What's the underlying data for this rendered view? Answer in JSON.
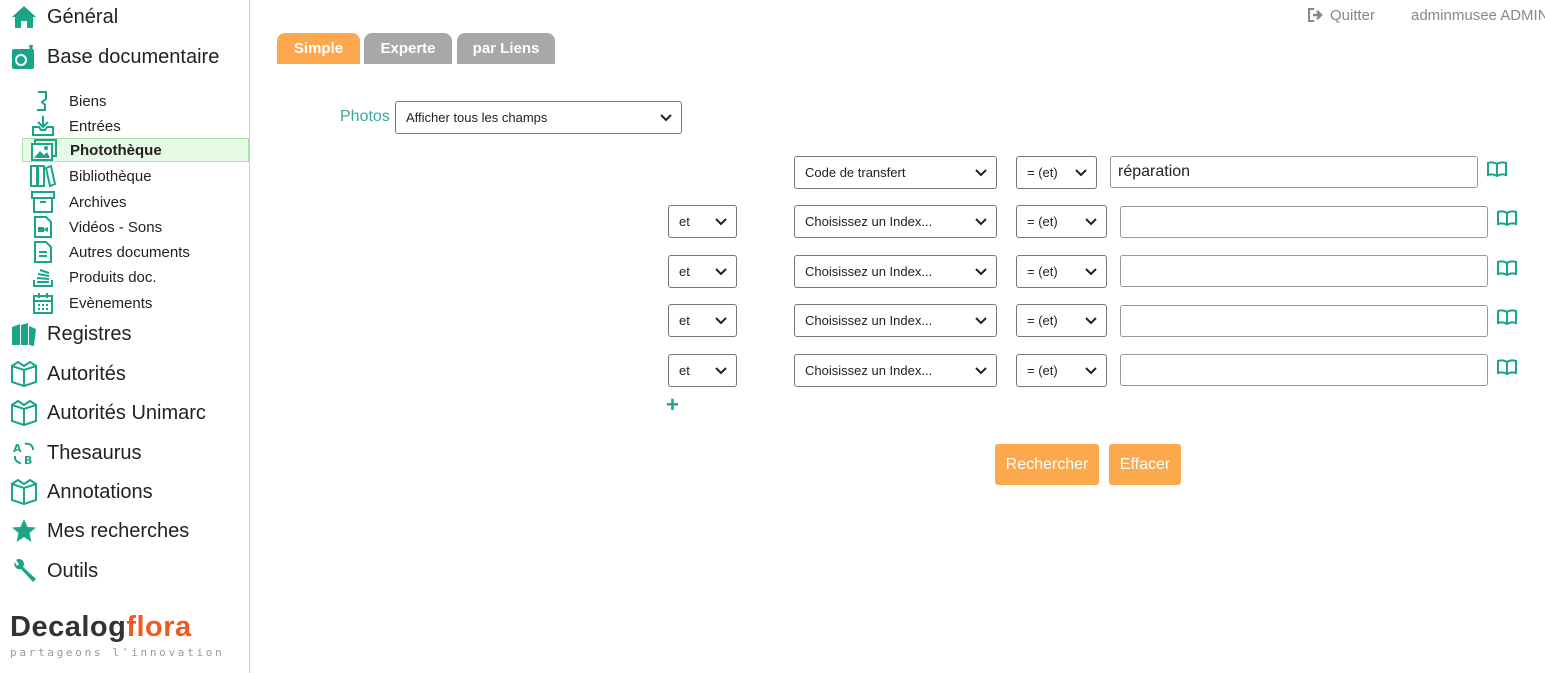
{
  "colors": {
    "accent": "#1aa58a",
    "tab_active": "#fba94c",
    "tab_inactive": "#a8a8a8",
    "brand_orange": "#ef5a20"
  },
  "sidebar": {
    "general": {
      "label": "Général",
      "icon": "home-icon"
    },
    "base_documentaire": {
      "label": "Base documentaire",
      "icon": "documents-icon"
    },
    "sub_items": [
      {
        "label": "Biens",
        "icon": "statue-icon"
      },
      {
        "label": "Entrées",
        "icon": "inbox-download-icon"
      },
      {
        "label": "Photothèque",
        "icon": "photos-icon",
        "active": true
      },
      {
        "label": "Bibliothèque",
        "icon": "books-icon"
      },
      {
        "label": "Archives",
        "icon": "archive-box-icon"
      },
      {
        "label": "Vidéos - Sons",
        "icon": "video-file-icon"
      },
      {
        "label": "Autres documents",
        "icon": "document-icon"
      },
      {
        "label": "Produits doc.",
        "icon": "stack-icon"
      },
      {
        "label": "Evènements",
        "icon": "calendar-icon"
      }
    ],
    "bottom_items": [
      {
        "label": "Registres",
        "icon": "registers-icon"
      },
      {
        "label": "Autorités",
        "icon": "open-box-icon"
      },
      {
        "label": "Autorités Unimarc",
        "icon": "open-box-icon"
      },
      {
        "label": "Thesaurus",
        "icon": "az-icon"
      },
      {
        "label": "Annotations",
        "icon": "open-box-icon"
      },
      {
        "label": "Mes recherches",
        "icon": "star-icon"
      },
      {
        "label": "Outils",
        "icon": "wrench-icon"
      }
    ],
    "logo": {
      "part1": "Decalog",
      "part2": "flora",
      "tagline": "partageons l'innovation"
    }
  },
  "topbar": {
    "quit_label": "Quitter",
    "user_label": "adminmusee ADMIN"
  },
  "tabs": [
    "Simple",
    "Experte",
    "par Liens"
  ],
  "form": {
    "photos_label": "Photos",
    "display_select": "Afficher tous les champs",
    "rows": [
      {
        "connector": "",
        "index": "Code de transfert",
        "operator": "= (et)",
        "value": "réparation"
      },
      {
        "connector": "et",
        "index": "Choisissez un Index...",
        "operator": "= (et)",
        "value": ""
      },
      {
        "connector": "et",
        "index": "Choisissez un Index...",
        "operator": "= (et)",
        "value": ""
      },
      {
        "connector": "et",
        "index": "Choisissez un Index...",
        "operator": "= (et)",
        "value": ""
      },
      {
        "connector": "et",
        "index": "Choisissez un Index...",
        "operator": "= (et)",
        "value": ""
      }
    ],
    "search_button": "Rechercher",
    "clear_button": "Effacer"
  }
}
